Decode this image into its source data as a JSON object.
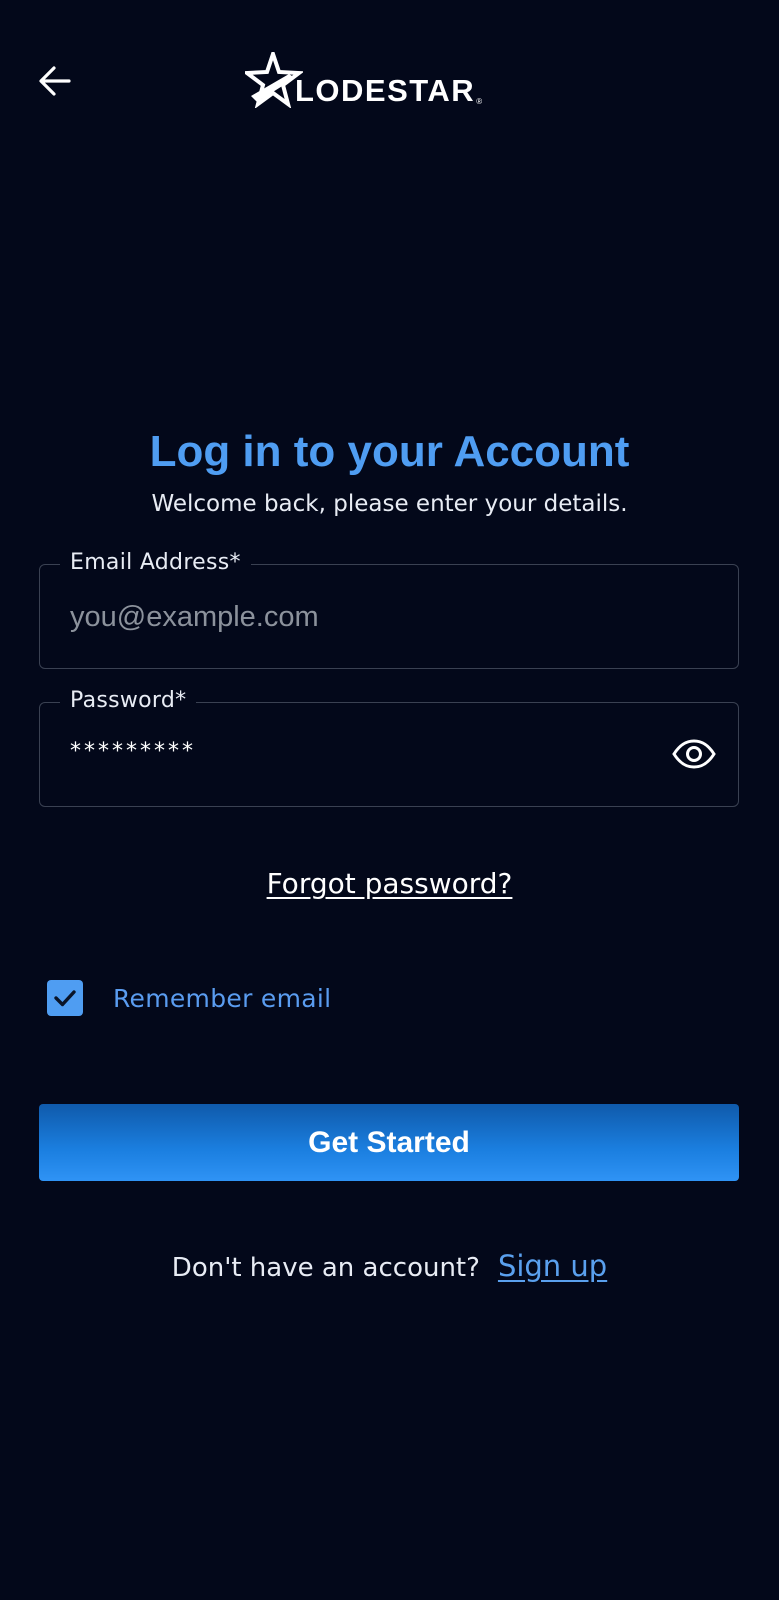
{
  "header": {
    "back_icon": "arrow-left-icon",
    "logo_text": "LODESTAR",
    "logo_mark": "®"
  },
  "login": {
    "title": "Log in to your Account",
    "subtitle": "Welcome back, please enter your details."
  },
  "email": {
    "label": "Email Address*",
    "placeholder": "you@example.com",
    "value": ""
  },
  "password": {
    "label": "Password*",
    "masked_value": "*********",
    "toggle_icon": "eye-icon"
  },
  "forgot_link": "Forgot password?",
  "remember": {
    "label": "Remember email",
    "checked": true
  },
  "submit_label": "Get Started",
  "signup": {
    "prompt": "Don't have an account?",
    "link": "Sign up"
  },
  "colors": {
    "background": "#03081a",
    "accent": "#4f9df2",
    "button_top": "#0f5aab",
    "button_bottom": "#2f93f5"
  }
}
